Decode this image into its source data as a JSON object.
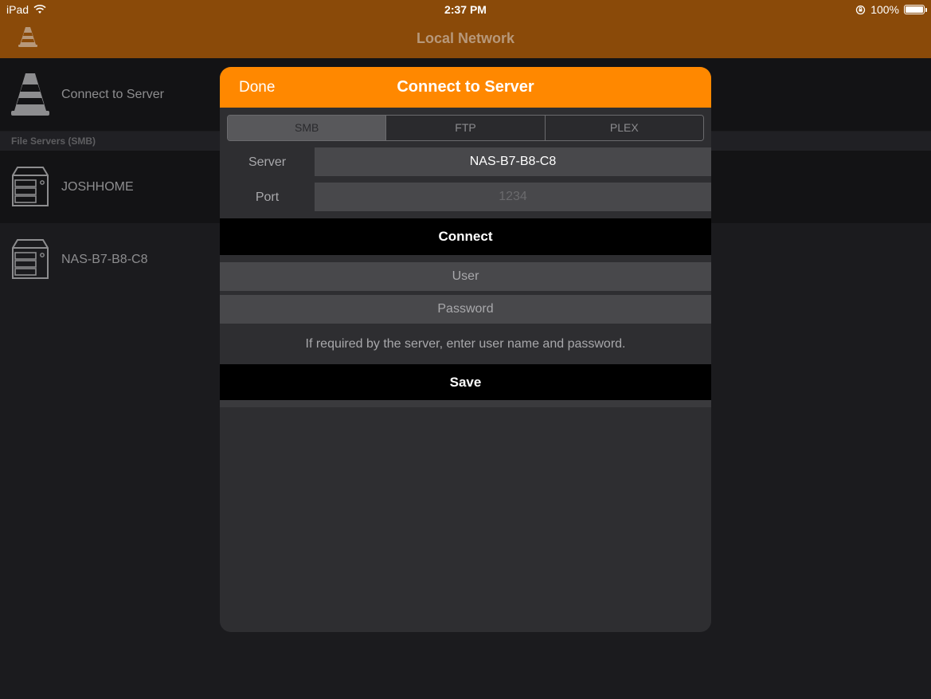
{
  "status_bar": {
    "device": "iPad",
    "time": "2:37 PM",
    "battery": "100%",
    "icons": [
      "wifi-icon",
      "rotation-lock-icon",
      "battery-icon"
    ]
  },
  "nav": {
    "title": "Local Network"
  },
  "list": {
    "connect_label": "Connect to Server",
    "section_header": "File Servers (SMB)",
    "servers": [
      {
        "name": "JOSHHOME"
      },
      {
        "name": "NAS-B7-B8-C8"
      }
    ]
  },
  "modal": {
    "done_label": "Done",
    "title": "Connect to Server",
    "tabs": [
      {
        "label": "SMB",
        "active": true
      },
      {
        "label": "FTP",
        "active": false
      },
      {
        "label": "PLEX",
        "active": false
      }
    ],
    "server_label": "Server",
    "server_value": "NAS-B7-B8-C8",
    "port_label": "Port",
    "port_placeholder": "1234",
    "connect_label": "Connect",
    "user_placeholder": "User",
    "password_placeholder": "Password",
    "hint": "If required by the server, enter user name and password.",
    "save_label": "Save"
  },
  "colors": {
    "accent": "#ff8800",
    "nav_bg_dimmed": "#8a4a09"
  }
}
